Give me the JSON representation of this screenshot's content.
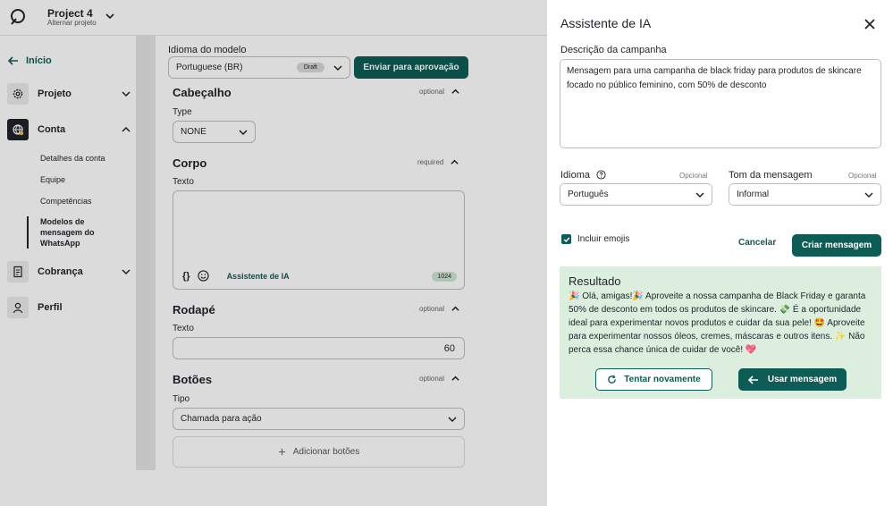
{
  "header": {
    "project_name": "Project 4",
    "project_switch": "Alternar projeto"
  },
  "sidebar": {
    "back_label": "Início",
    "items": [
      {
        "label": "Projeto",
        "icon": "gear-icon"
      },
      {
        "label": "Conta",
        "icon": "globe-icon"
      },
      {
        "label": "Cobrança",
        "icon": "invoice-icon"
      },
      {
        "label": "Perfil",
        "icon": "user-icon"
      }
    ],
    "sub_items": [
      "Detalhes da conta",
      "Equipe",
      "Competências",
      "Modelos de mensagem do WhatsApp"
    ]
  },
  "editor": {
    "language_label": "Idioma do modelo",
    "language_value": "Portuguese (BR)",
    "draft_badge": "Draft",
    "submit_label": "Enviar para aprovação",
    "header_title": "Cabeçalho",
    "header_flag": "optional",
    "type_label": "Type",
    "type_value": "NONE",
    "body_title": "Corpo",
    "body_flag": "required",
    "body_text_label": "Texto",
    "body_braces": "{}",
    "ai_assistant_link": "Assistente de IA",
    "body_count": "1024",
    "footer_title": "Rodapé",
    "footer_flag": "optional",
    "footer_text_label": "Texto",
    "footer_count": "60",
    "buttons_title": "Botões",
    "buttons_flag": "optional",
    "tipo_label": "Tipo",
    "tipo_value": "Chamada para ação",
    "add_buttons_label": "Adicionar botões"
  },
  "assistant": {
    "title": "Assistente de IA",
    "description_label": "Descrição da campanha",
    "description_value": "Mensagem para uma campanha de black friday para produtos de skincare focado no público feminino, com 50% de desconto",
    "language_label": "Idioma",
    "language_hint": "Opcional",
    "language_value": "Português",
    "tone_label": "Tom da mensagem",
    "tone_hint": "Opcional",
    "tone_value": "Informal",
    "include_emojis_label": "Incluir emojis",
    "cancel_label": "Cancelar",
    "create_label": "Criar mensagem",
    "result_title": "Resultado",
    "result_text": "🎉 Olá, amigas!🎉 Aproveite a nossa campanha de Black Friday e garanta 50% de desconto em todos os produtos de skincare. 💸 É a oportunidade ideal para experimentar novos produtos e cuidar da sua pele! 🤩 Aproveite para experimentar nossos óleos, cremes, máscaras e outros itens. ✨ Não perca essa chance única de cuidar de você! 💖",
    "retry_label": "Tentar novamente",
    "use_label": "Usar mensagem"
  },
  "colors": {
    "primary": "#0d5c55",
    "result_bg": "#dcefdf"
  }
}
